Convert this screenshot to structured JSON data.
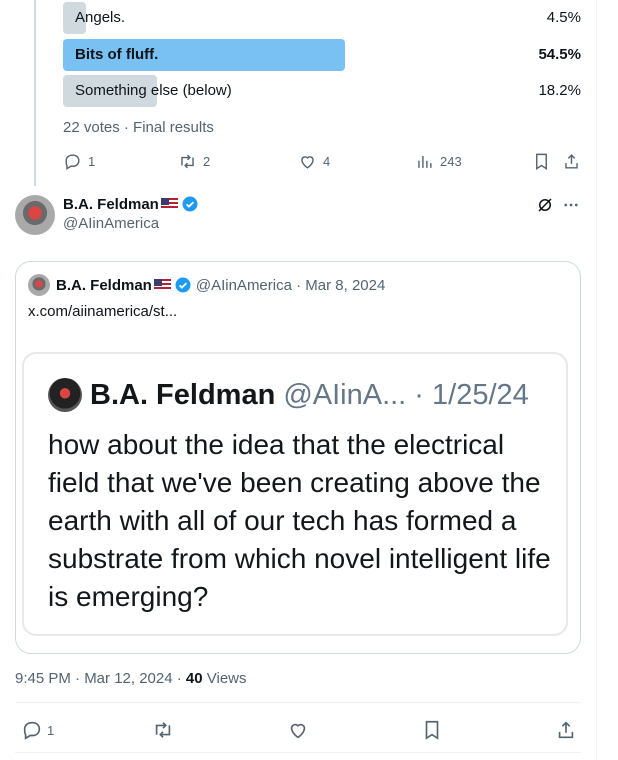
{
  "poll": {
    "options": [
      {
        "label": "Angels.",
        "percent": "4.5%",
        "fraction": 0.045
      },
      {
        "label": "Bits of fluff.",
        "percent": "54.5%",
        "fraction": 0.545
      },
      {
        "label": "Something else (below)",
        "percent": "18.2%",
        "fraction": 0.182
      }
    ],
    "meta": "22 votes · Final results"
  },
  "tweet_actions": {
    "replies": "1",
    "reposts": "2",
    "likes": "4",
    "views": "243"
  },
  "author": {
    "name": "B.A. Feldman",
    "handle": "@AIinAmerica"
  },
  "quote": {
    "name": "B.A. Feldman",
    "handle_date": "@AIinAmerica · Mar 8, 2024",
    "link": "x.com/aiinamerica/st...",
    "card": {
      "name": "B.A. Feldman",
      "handle_date": "@AIinA... · 1/25/24",
      "text": "how about the idea that the electrical field that we've been creating above the earth with all of our tech has formed a substrate from which novel intelligent life is emerging?"
    }
  },
  "timestamp": {
    "time": "9:45 PM · Mar 12, 2024 · ",
    "views_count": "40",
    "views_label": " Views"
  },
  "bottom_actions": {
    "replies": "1"
  },
  "colors": {
    "accent": "#1d9bf0",
    "poll_winner": "#79c1f2",
    "poll_other": "#cfd9de",
    "muted": "#536471"
  }
}
